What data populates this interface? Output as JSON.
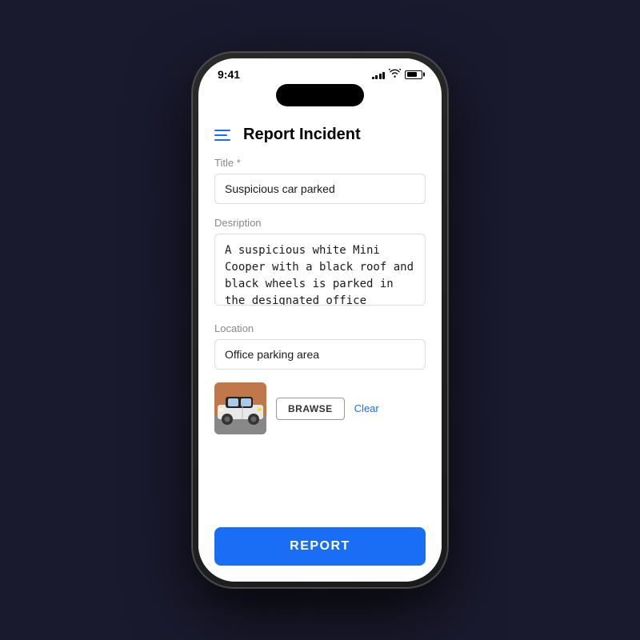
{
  "status_bar": {
    "time": "9:41"
  },
  "header": {
    "title": "Report Incident"
  },
  "form": {
    "title_label": "Title *",
    "title_value": "Suspicious car parked",
    "description_label": "Desription",
    "description_value": "A suspicious white Mini Cooper with a black roof and black wheels is parked in the designated office parking area.",
    "location_label": "Location",
    "location_value": "Office parking area"
  },
  "upload": {
    "browse_label": "BRAWSE",
    "clear_label": "Clear"
  },
  "footer": {
    "report_label": "REPORT"
  },
  "icons": {
    "hamburger": "menu-icon",
    "signal": "signal-icon",
    "wifi": "wifi-icon",
    "battery": "battery-icon"
  }
}
